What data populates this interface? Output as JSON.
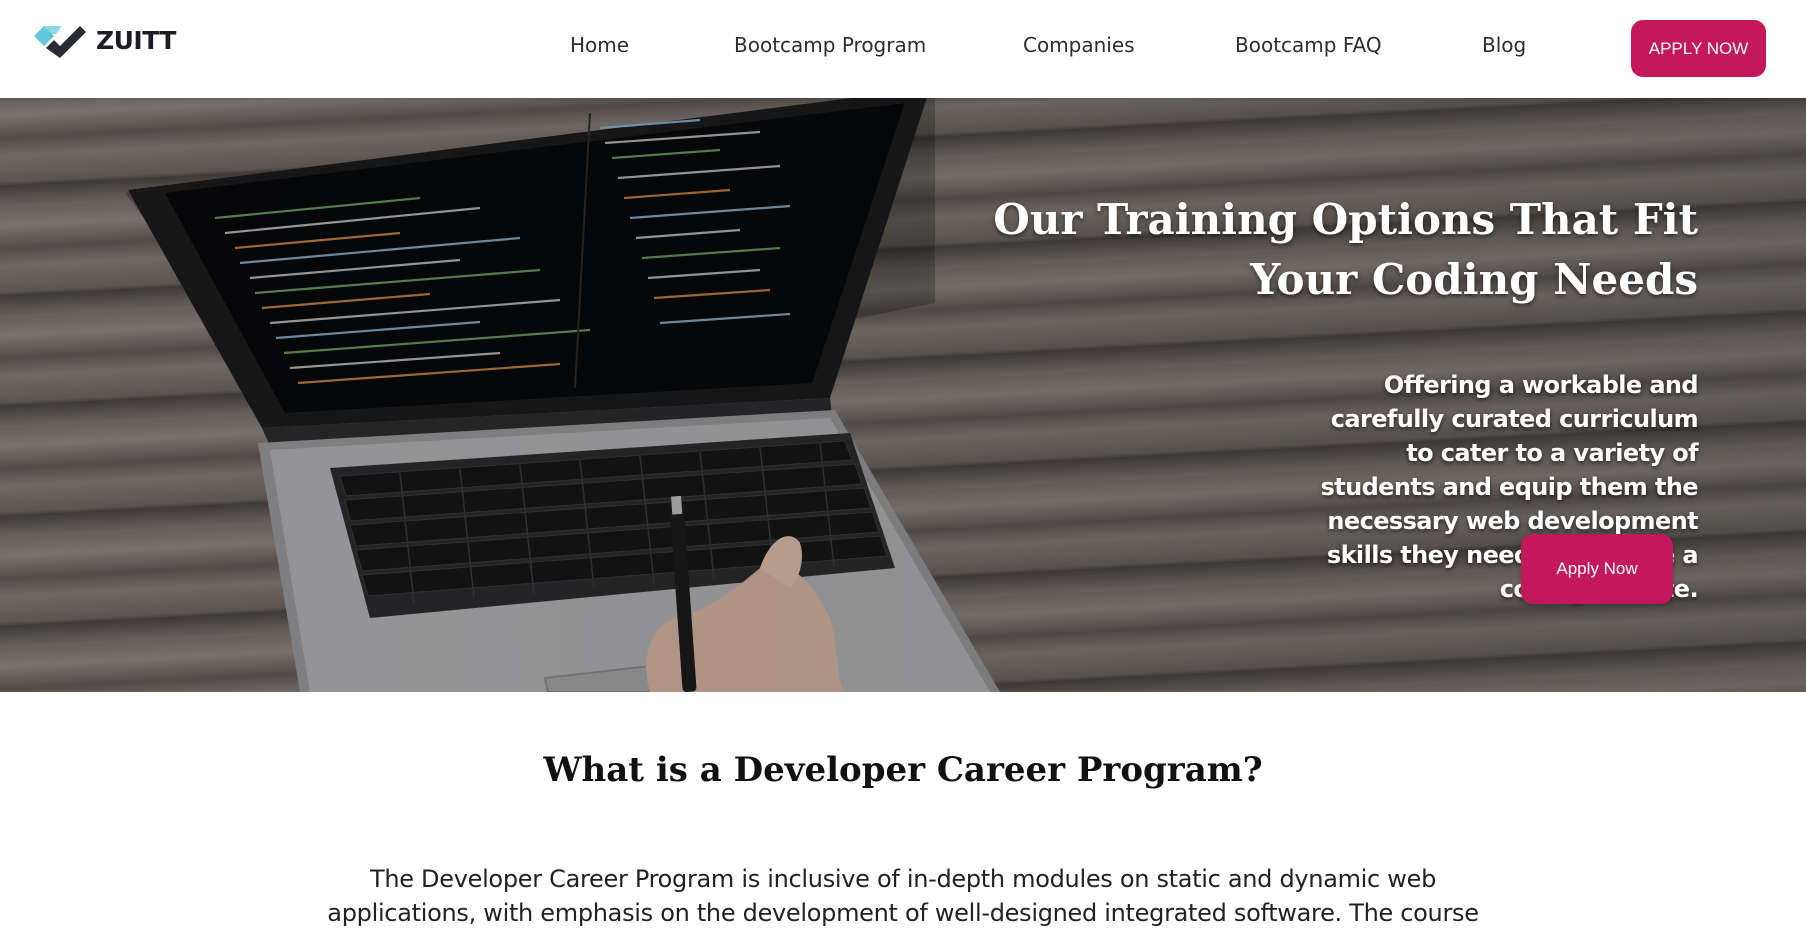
{
  "brand": {
    "name": "ZUITT",
    "logo_icon": "zuitt-check-logo",
    "colors": {
      "teal": "#5ec8d8",
      "dark": "#2b2b36"
    }
  },
  "nav": {
    "items": [
      {
        "label": "Home"
      },
      {
        "label": "Bootcamp Program"
      },
      {
        "label": "Companies"
      },
      {
        "label": "Bootcamp FAQ"
      },
      {
        "label": "Blog"
      }
    ],
    "apply_label": "APPLY NOW"
  },
  "hero": {
    "title": "Our Training Options That Fit Your Coding Needs",
    "description": "Offering a workable and carefully curated curriculum to cater to a variety of students and equip them the necessary web development skills they need to become a coding literate.",
    "apply_label": "Apply Now"
  },
  "content": {
    "heading": "What is a Developer Career Program?",
    "body": "The Developer Career Program is inclusive of in-depth modules on static and dynamic web applications, with emphasis on the development of well-designed integrated software. The course"
  },
  "colors": {
    "accent": "#c3185a"
  }
}
